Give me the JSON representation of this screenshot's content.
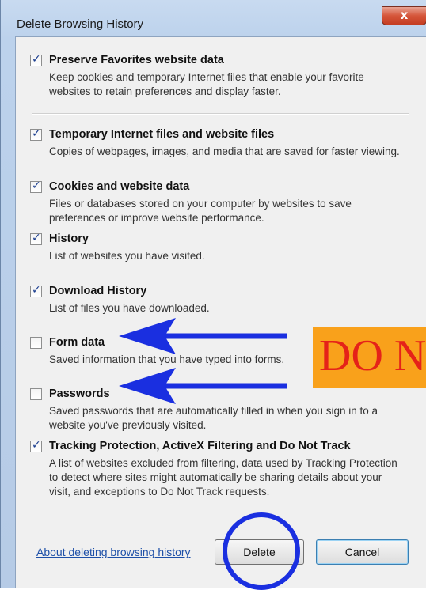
{
  "dialog": {
    "title": "Delete Browsing History",
    "close_glyph": "x"
  },
  "items": [
    {
      "label": "Preserve Favorites website data",
      "checked": true,
      "description": "Keep cookies and temporary Internet files that enable your favorite websites to retain preferences and display faster."
    },
    {
      "label": "Temporary Internet files and website files",
      "checked": true,
      "description": "Copies of webpages, images, and media that are saved for faster viewing."
    },
    {
      "label": "Cookies and website data",
      "checked": true,
      "description": "Files or databases stored on your computer by websites to save preferences or improve website performance."
    },
    {
      "label": "History",
      "checked": true,
      "description": "List of websites you have visited."
    },
    {
      "label": "Download History",
      "checked": true,
      "description": "List of files you have downloaded."
    },
    {
      "label": "Form data",
      "checked": false,
      "description": "Saved information that you have typed into forms."
    },
    {
      "label": "Passwords",
      "checked": false,
      "description": "Saved passwords that are automatically filled in when you sign in to a website you've previously visited."
    },
    {
      "label": "Tracking Protection, ActiveX Filtering and Do Not Track",
      "checked": true,
      "description": "A list of websites excluded from filtering, data used by Tracking Protection to detect where sites might automatically be sharing details about your visit, and exceptions to Do Not Track requests."
    }
  ],
  "footer": {
    "help_link": "About deleting browsing history",
    "delete_label": "Delete",
    "cancel_label": "Cancel"
  },
  "annotations": {
    "banner_text": "DO N",
    "arrow_color": "#1a2fe0",
    "banner_color": "#f9a11b",
    "banner_text_color": "#e52219"
  }
}
